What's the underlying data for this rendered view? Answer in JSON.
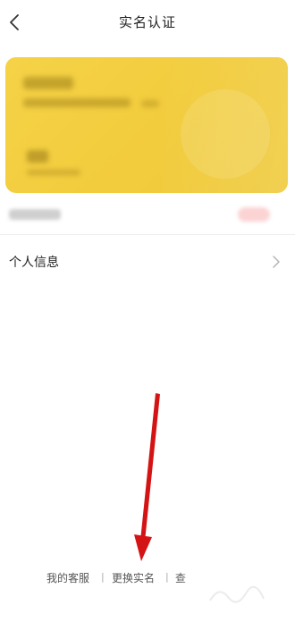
{
  "header": {
    "title": "实名认证",
    "back_icon": "chevron-left-icon"
  },
  "card": {
    "color": "#f3ce40"
  },
  "info_row": {
    "label": "个人信息",
    "chevron_icon": "chevron-right-icon"
  },
  "footer": {
    "links": [
      "我的客服",
      "更换实名",
      "查"
    ],
    "separator": "|"
  },
  "annotation": {
    "arrow_color": "#d41414"
  }
}
